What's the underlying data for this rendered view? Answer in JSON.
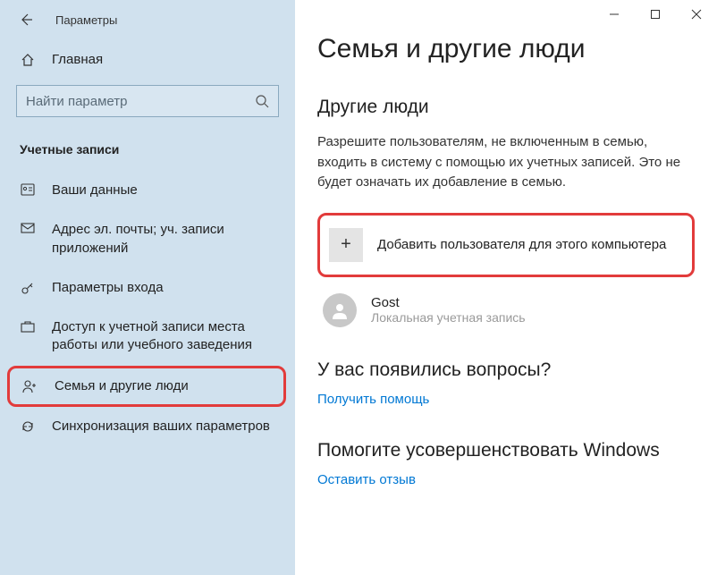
{
  "window": {
    "title": "Параметры"
  },
  "sidebar": {
    "home_label": "Главная",
    "search_placeholder": "Найти параметр",
    "category": "Учетные записи",
    "items": [
      {
        "label": "Ваши данные"
      },
      {
        "label": "Адрес эл. почты; уч. записи приложений"
      },
      {
        "label": "Параметры входа"
      },
      {
        "label": "Доступ к учетной записи места работы или учебного заведения"
      },
      {
        "label": "Семья и другие люди"
      },
      {
        "label": "Синхронизация ваших параметров"
      }
    ]
  },
  "main": {
    "title": "Семья и другие люди",
    "section1": {
      "heading": "Другие люди",
      "desc": "Разрешите пользователям, не включенным в семью, входить в систему с помощью их учетных записей. Это не будет означать их добавление в семью.",
      "add_label": "Добавить пользователя для этого компьютера",
      "user": {
        "name": "Gost",
        "type": "Локальная учетная запись"
      }
    },
    "section2": {
      "heading": "У вас появились вопросы?",
      "link": "Получить помощь"
    },
    "section3": {
      "heading": "Помогите усовершенствовать Windows",
      "link": "Оставить отзыв"
    }
  }
}
